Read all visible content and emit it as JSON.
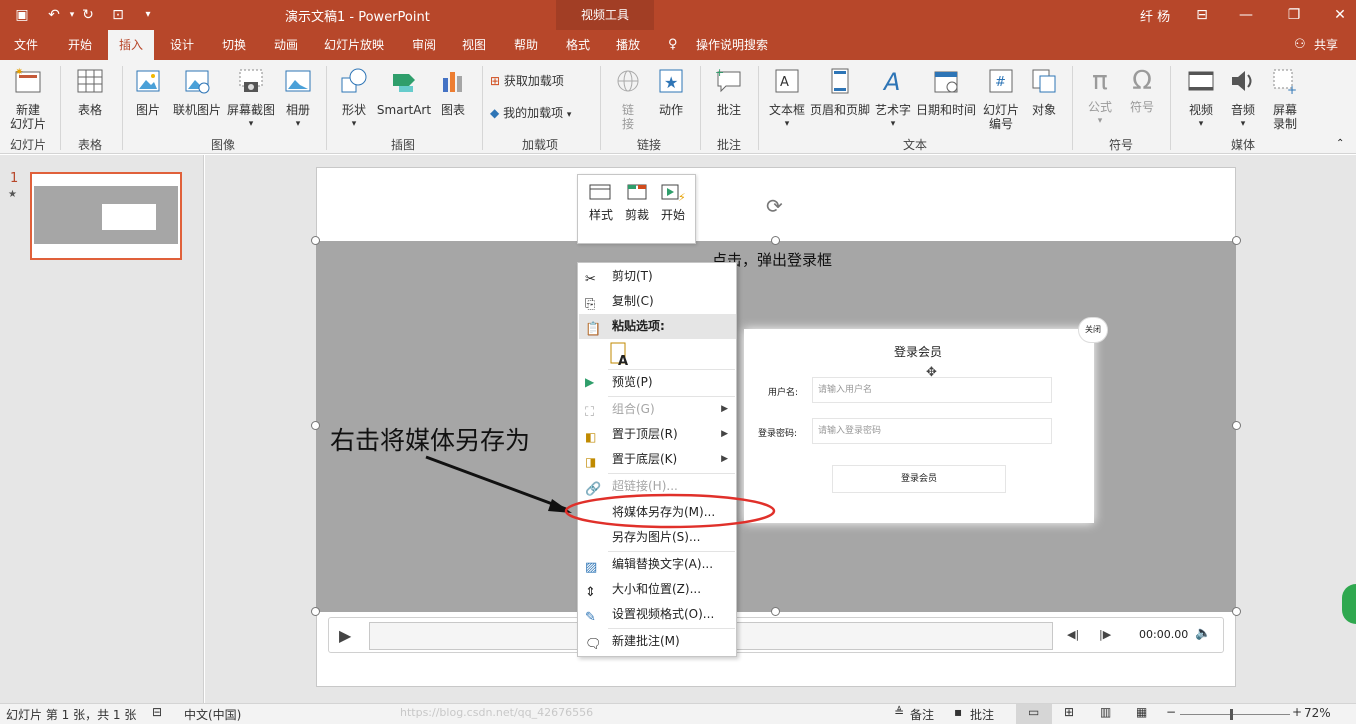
{
  "titlebar": {
    "title": "演示文稿1  -  PowerPoint",
    "context_group": "视频工具",
    "user": "纤 杨"
  },
  "tabs": [
    "文件",
    "开始",
    "插入",
    "设计",
    "切换",
    "动画",
    "幻灯片放映",
    "审阅",
    "视图",
    "帮助",
    "格式",
    "播放"
  ],
  "tell_me": "操作说明搜索",
  "share": "共享",
  "ribbon": {
    "groups": [
      "幻灯片",
      "表格",
      "图像",
      "插图",
      "加载项",
      "链接",
      "批注",
      "文本",
      "符号",
      "媒体"
    ],
    "new_slide": [
      "新建",
      "幻灯片"
    ],
    "table": "表格",
    "picture": "图片",
    "online_picture": "联机图片",
    "screenshot": "屏幕截图",
    "album": "相册",
    "shapes": "形状",
    "smartart": "SmartArt",
    "chart": "图表",
    "get_addins": "获取加载项",
    "my_addins": "我的加载项",
    "link": [
      "链",
      "接"
    ],
    "action": "动作",
    "comment": "批注",
    "textbox": "文本框",
    "header_footer": "页眉和页脚",
    "wordart": "艺术字",
    "datetime": "日期和时间",
    "slide_number": [
      "幻灯片",
      "编号"
    ],
    "object": "对象",
    "equation": "公式",
    "symbol": "符号",
    "video": "视频",
    "audio": "音频",
    "screen_record": [
      "屏幕",
      "录制"
    ]
  },
  "thumbnail": {
    "number": "1",
    "star": "★"
  },
  "slide": {
    "heading": "点击，弹出登录框",
    "annotation": "右击将媒体另存为",
    "login": {
      "close": "关闭",
      "title": "登录会员",
      "user_label": "用户名:",
      "user_placeholder": "请输入用户名",
      "pwd_label": "登录密码:",
      "pwd_placeholder": "请输入登录密码",
      "button": "登录会员"
    },
    "player": {
      "time": "00:00.00"
    }
  },
  "mini_toolbar": [
    "样式",
    "剪裁",
    "开始"
  ],
  "context_menu": [
    {
      "label": "剪切(T)",
      "disabled": false
    },
    {
      "label": "复制(C)",
      "disabled": false
    },
    {
      "label": "粘贴选项:",
      "disabled": false
    },
    {
      "label": "预览(P)",
      "disabled": false
    },
    {
      "label": "组合(G)",
      "disabled": true
    },
    {
      "label": "置于顶层(R)",
      "disabled": false
    },
    {
      "label": "置于底层(K)",
      "disabled": false
    },
    {
      "label": "超链接(H)...",
      "disabled": true
    },
    {
      "label": "将媒体另存为(M)...",
      "disabled": false
    },
    {
      "label": "另存为图片(S)...",
      "disabled": false
    },
    {
      "label": "编辑替换文字(A)...",
      "disabled": false
    },
    {
      "label": "大小和位置(Z)...",
      "disabled": false
    },
    {
      "label": "设置视频格式(O)...",
      "disabled": false
    },
    {
      "label": "新建批注(M)",
      "disabled": false
    }
  ],
  "status": {
    "slide_info": "幻灯片 第 1 张，共 1 张",
    "language": "中文(中国)",
    "notes": "备注",
    "comments": "批注",
    "zoom": "72%",
    "watermark": "https://blog.csdn.net/qq_42676556"
  },
  "colors": {
    "accent": "#b7472a",
    "highlight_ellipse": "#e0302a",
    "menu_hover": "#e5e5e5"
  }
}
